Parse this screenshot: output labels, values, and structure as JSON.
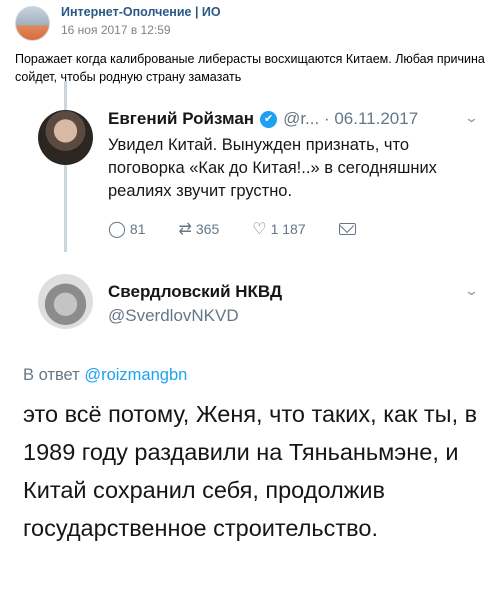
{
  "post": {
    "author": "Интернет-Ополчение | ИО",
    "date": "16 ноя 2017 в 12:59",
    "text": "Поражает когда калиброваные либерасты восхищаются Китаем. Любая причина сойдет, чтобы родную страну замазать"
  },
  "tweet1": {
    "name": "Евгений Ройзман",
    "verified_icon": "✔",
    "handle_date": "@r... · 06.11.2017",
    "text": "Увидел Китай. Вынужден признать, что поговорка «Как до Китая!..» в сегодняшних реалиях звучит грустно.",
    "replies": "81",
    "retweets": "365",
    "likes": "1 187"
  },
  "tweet2": {
    "name": "Свердловский НКВД",
    "handle": "@SverdlovNKVD",
    "reply_label": "В ответ",
    "reply_handle": "@roizmangbn",
    "text": "это всё потому, Женя, что таких, как ты, в 1989 году раздавили на Тяньаньмэне, и Китай сохранил себя, продолжив государственное строительство."
  },
  "icons": {
    "chevron": "⌄",
    "reply": "◯",
    "retweet": "⇄",
    "like": "♡"
  },
  "colors": {
    "vk_link": "#2a5885",
    "twitter_blue": "#1da1f2",
    "muted": "#657786"
  }
}
